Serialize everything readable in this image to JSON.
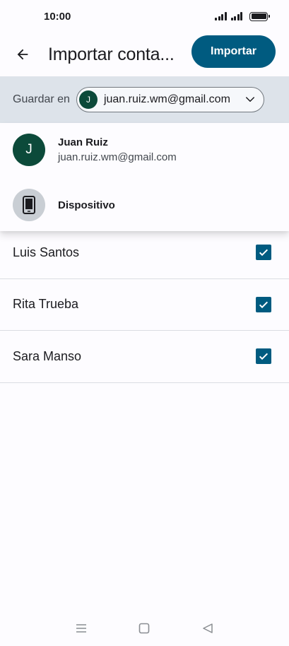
{
  "status": {
    "time": "10:00"
  },
  "app_bar": {
    "title": "Importar conta...",
    "import_label": "Importar"
  },
  "save_bar": {
    "label": "Guardar en",
    "avatar_initial": "J",
    "selected_account": "juan.ruiz.wm@gmail.com"
  },
  "dropdown": {
    "items": [
      {
        "initial": "J",
        "name": "Juan Ruiz",
        "email": "juan.ruiz.wm@gmail.com"
      },
      {
        "name": "Dispositivo",
        "icon": "smartphone-icon"
      }
    ]
  },
  "contacts": [
    {
      "name": "Luis Santos",
      "checked": true
    },
    {
      "name": "Rita Trueba",
      "checked": true
    },
    {
      "name": "Sara Manso",
      "checked": true
    }
  ],
  "colors": {
    "accent": "#005b80",
    "avatar": "#0c4a3a",
    "save_bar_bg": "#dde3ea"
  }
}
